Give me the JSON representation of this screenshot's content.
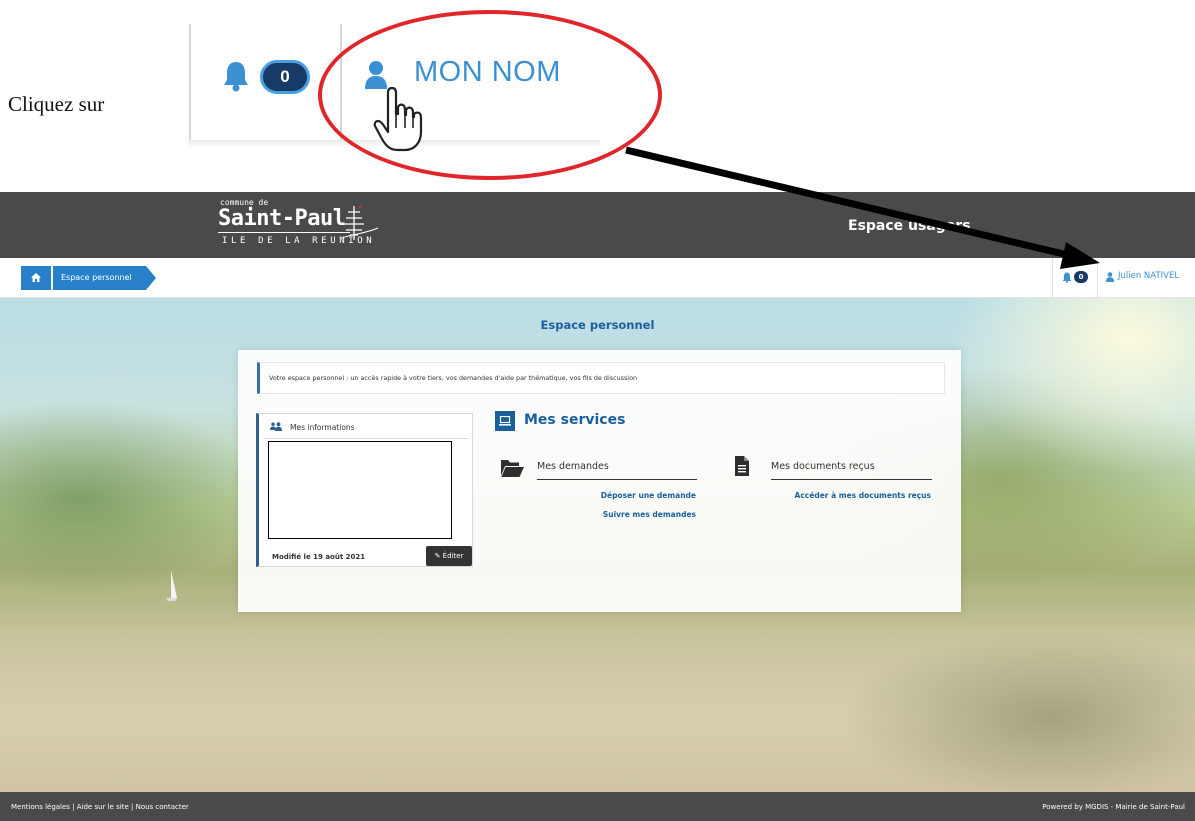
{
  "instruction": {
    "text": "Cliquez sur",
    "zoom_badge_count": "0",
    "zoom_name": "MON NOM"
  },
  "header": {
    "logo_line1": "commune de",
    "logo_line2": "Saint-Paul",
    "logo_line3": "ILE DE LA REUNION",
    "title": "Espace usagers"
  },
  "breadcrumb": {
    "home_icon": "home-icon",
    "item": "Espace personnel"
  },
  "toolbar": {
    "notification_count": "0",
    "user_name": "Julien NATIVEL"
  },
  "page": {
    "title": "Espace personnel",
    "info_text": "Votre espace personnel : un accès rapide à votre tiers, vos demandes d'aide par thématique, vos fils de discussion"
  },
  "mes_informations": {
    "title": "Mes informations",
    "modified": "Modifié le 19 août 2021",
    "edit_button": "Éditer"
  },
  "services": {
    "title": "Mes services",
    "demandes": {
      "title": "Mes demandes",
      "link1": "Déposer une demande",
      "link2": "Suivre mes demandes"
    },
    "documents": {
      "title": "Mes documents reçus",
      "link": "Accéder à mes documents reçus"
    }
  },
  "footer": {
    "left": "Mentions légales | Aide sur le site | Nous contacter",
    "right": "Powered by MGDIS - Mairie de Saint-Paul"
  },
  "colors": {
    "accent": "#2780c8",
    "title_blue": "#1a5e9c",
    "header_bg": "#4a4a4a",
    "highlight_red": "#e0262a"
  }
}
